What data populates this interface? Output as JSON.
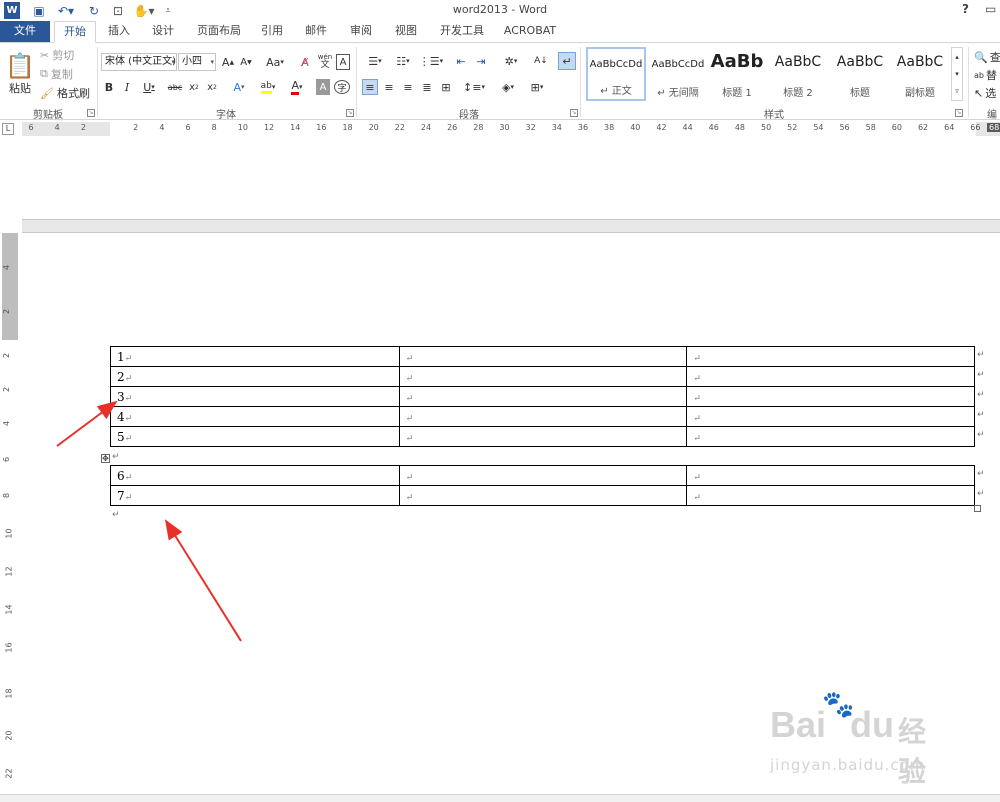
{
  "window": {
    "title": "word2013 - Word",
    "help": "?",
    "restore": "▭"
  },
  "tabs": [
    "文件",
    "开始",
    "插入",
    "设计",
    "页面布局",
    "引用",
    "邮件",
    "审阅",
    "视图",
    "开发工具",
    "ACROBAT"
  ],
  "clipboard": {
    "paste": "粘贴",
    "cut": "剪切",
    "copy": "复制",
    "format_painter": "格式刷",
    "group": "剪贴板"
  },
  "font": {
    "name": "宋体 (中文正文)",
    "size": "小四",
    "group": "字体",
    "case": "Aa",
    "phonetic": "wén",
    "phonetic_sub": "文"
  },
  "paragraph": {
    "group": "段落"
  },
  "styles": {
    "group": "样式",
    "items": [
      {
        "sample": "AaBbCcDd",
        "label": "↵ 正文"
      },
      {
        "sample": "AaBbCcDd",
        "label": "↵ 无间隔"
      },
      {
        "sample": "AaBb",
        "label": "标题 1"
      },
      {
        "sample": "AaBbC",
        "label": "标题 2"
      },
      {
        "sample": "AaBbC",
        "label": "标题"
      },
      {
        "sample": "AaBbC",
        "label": "副标题"
      }
    ]
  },
  "editing": {
    "find": "查",
    "replace": "替",
    "select": "选",
    "group": "编"
  },
  "ruler": {
    "left_nums": [
      "6",
      "4",
      "2"
    ],
    "nums": [
      "2",
      "4",
      "6",
      "8",
      "10",
      "12",
      "14",
      "16",
      "18",
      "20",
      "22",
      "24",
      "26",
      "28",
      "30",
      "32",
      "34",
      "36",
      "38",
      "40",
      "42",
      "44",
      "46",
      "48",
      "50",
      "52",
      "54",
      "56",
      "58",
      "60",
      "62",
      "64",
      "66"
    ],
    "end": "68",
    "corner": "L"
  },
  "vruler_nums": [
    "4",
    "2",
    "2",
    "2",
    "4",
    "6",
    "8",
    "10",
    "12",
    "14",
    "16",
    "18",
    "20",
    "22"
  ],
  "tables": [
    {
      "rows": [
        "1",
        "2",
        "3",
        "4",
        "5"
      ]
    },
    {
      "rows": [
        "6",
        "7"
      ]
    }
  ],
  "marks": {
    "para": "↵",
    "move_handle": "✥"
  },
  "watermark": {
    "brand": "Bai",
    "brand2": "du",
    "cn": "经验",
    "url": "jingyan.baidu.com"
  },
  "colors": {
    "accent": "#2b579a",
    "arrow": "#e8302a"
  }
}
